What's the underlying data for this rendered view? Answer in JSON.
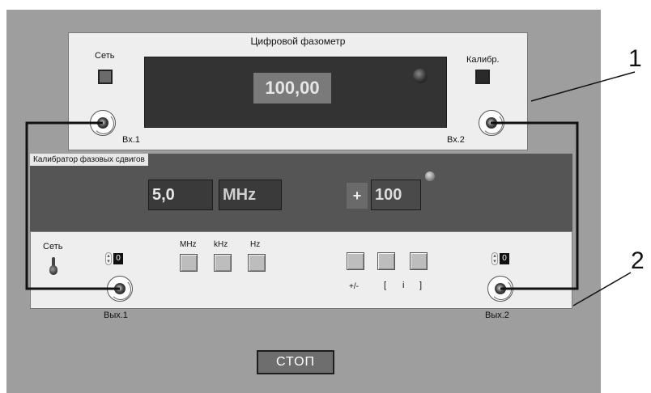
{
  "phasemeter": {
    "title": "Цифровой фазометр",
    "power_label": "Сеть",
    "calibrate_label": "Калибр.",
    "readout": "100,00",
    "input1_label": "Вх.1",
    "input2_label": "Вх.2"
  },
  "calibrator": {
    "title": "Калибратор фазовых сдвигов",
    "frequency": "5,0",
    "frequency_unit": "MHz",
    "phase_sign": "+",
    "phase": "100"
  },
  "controls": {
    "power_label": "Сеть",
    "spinner_left_value": "0",
    "spinner_right_value": "0",
    "unit_mhz": "MHz",
    "unit_khz": "kHz",
    "unit_hz": "Hz",
    "sign_label": "+/-",
    "bracket_open": "[",
    "index_label": "i",
    "bracket_close": "]",
    "output1_label": "Вых.1",
    "output2_label": "Вых.2"
  },
  "stop_label": "СТОП",
  "callouts": {
    "one": "1",
    "two": "2"
  }
}
